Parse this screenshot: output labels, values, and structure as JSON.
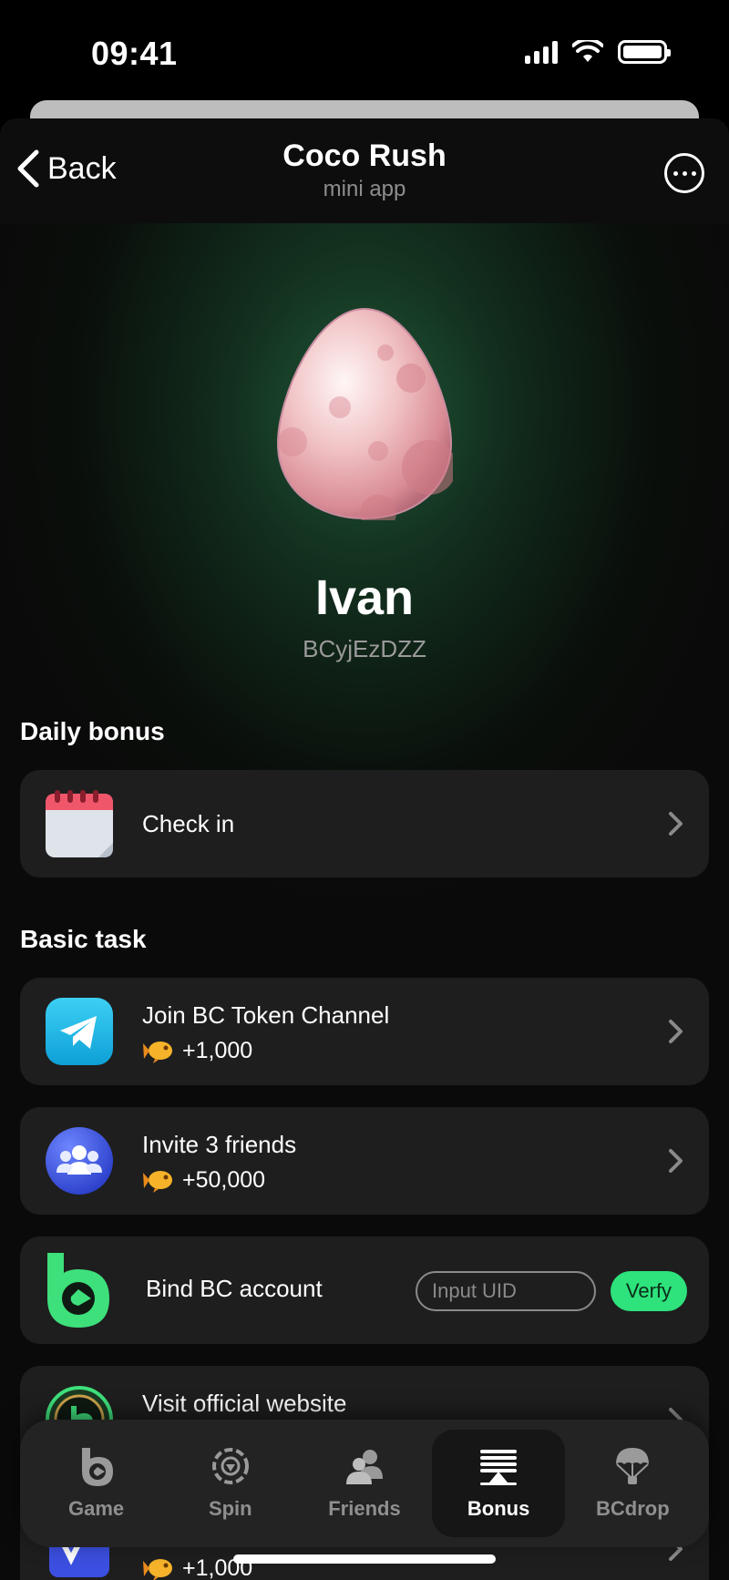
{
  "status_bar": {
    "time": "09:41"
  },
  "header": {
    "back_label": "Back",
    "title": "Coco Rush",
    "subtitle": "mini app"
  },
  "profile": {
    "name": "Ivan",
    "id": "BCyjEzDZZ"
  },
  "daily_bonus": {
    "title": "Daily bonus",
    "check_in_label": "Check in"
  },
  "basic_task": {
    "title": "Basic task",
    "items": [
      {
        "label": "Join BC Token Channel",
        "reward": "+1,000",
        "icon": "telegram-icon"
      },
      {
        "label": "Invite 3 friends",
        "reward": "+50,000",
        "icon": "friends-icon"
      },
      {
        "label": "Bind BC account",
        "input_placeholder": "Input UID",
        "button_label": "Verfy",
        "icon": "bc-logo-icon"
      },
      {
        "label": "Visit official website",
        "icon": "website-icon"
      },
      {
        "reward": "+1,000",
        "icon": "wallet-icon"
      }
    ]
  },
  "nav": {
    "items": [
      {
        "label": "Game",
        "icon": "game-icon"
      },
      {
        "label": "Spin",
        "icon": "spin-icon"
      },
      {
        "label": "Friends",
        "icon": "friends-icon"
      },
      {
        "label": "Bonus",
        "icon": "bonus-icon",
        "active": true
      },
      {
        "label": "BCdrop",
        "icon": "parachute-icon"
      }
    ]
  },
  "colors": {
    "accent": "#2ee27c",
    "card": "#1e1e1e",
    "background": "#0a0a0a"
  }
}
